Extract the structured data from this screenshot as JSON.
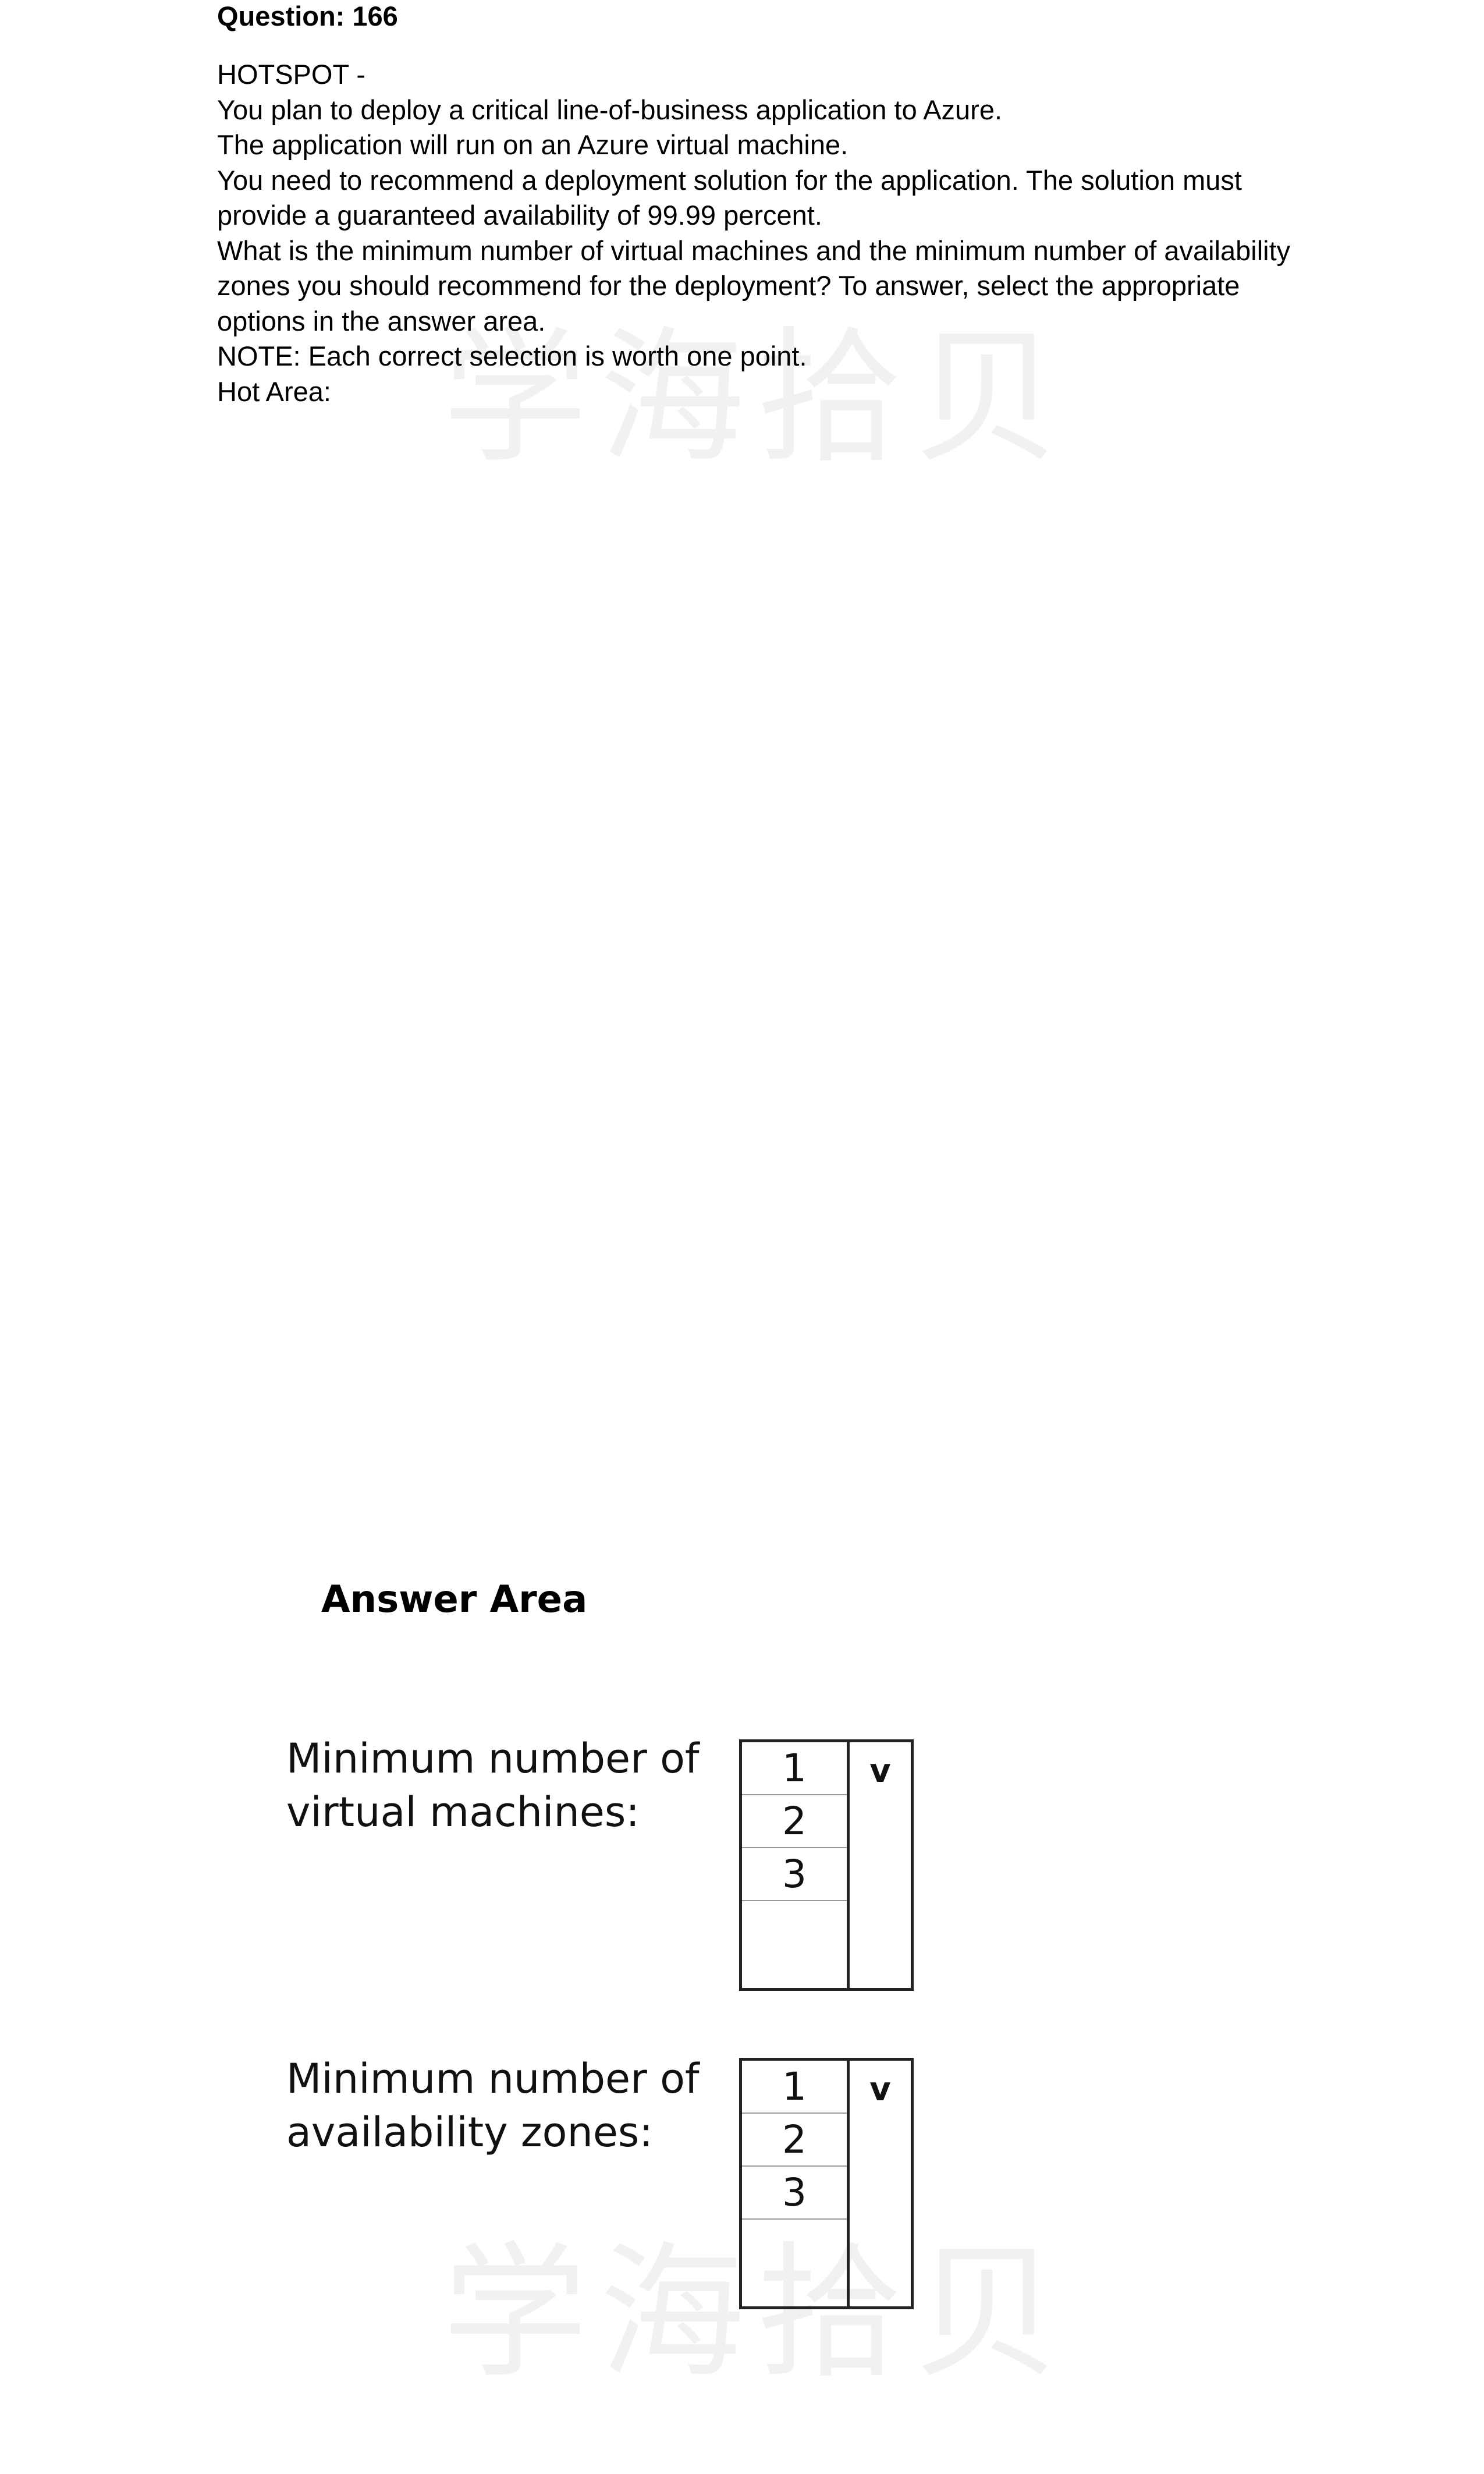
{
  "question": {
    "title": "Question: 166",
    "lines": [
      "HOTSPOT -",
      "You plan to deploy a critical line-of-business application to Azure.",
      "The application will run on an Azure virtual machine.",
      "You need to recommend a deployment solution for the application. The solution must",
      "provide a guaranteed availability of 99.99 percent.",
      "What is the minimum number of virtual machines and the minimum number of availability",
      "zones you should recommend for the deployment? To answer, select the appropriate",
      "options in the answer area.",
      "NOTE: Each correct selection is worth one point.",
      "Hot Area:"
    ]
  },
  "answer_area": {
    "heading": "Answer Area",
    "fields": [
      {
        "label_line1": "Minimum number of",
        "label_line2": "virtual machines:",
        "options": [
          "1",
          "2",
          "3"
        ],
        "chevron_icon": "chevron-down-icon"
      },
      {
        "label_line1": "Minimum number of",
        "label_line2": "availability zones:",
        "options": [
          "1",
          "2",
          "3"
        ],
        "chevron_icon": "chevron-down-icon"
      }
    ]
  },
  "watermark": {
    "text": "学海拾贝"
  }
}
